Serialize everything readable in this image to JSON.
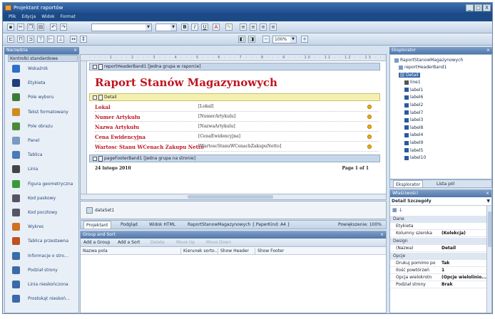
{
  "window": {
    "title": "Projektant raportów",
    "buttons": [
      "_",
      "□",
      "X"
    ]
  },
  "menu": [
    "Plik",
    "Edycja",
    "Widok",
    "Format"
  ],
  "toolbar": {
    "zoom": "100%",
    "zoom_icon": "zoom-icon"
  },
  "toolbox": {
    "title": "Narzędzia",
    "section": "Kontrolki standardowe",
    "items": [
      {
        "label": "Wskaźnik",
        "icon": "pointer-icon",
        "color": "#2c6fc9"
      },
      {
        "label": "Etykieta",
        "icon": "label-icon",
        "color": "#1f3f7a"
      },
      {
        "label": "Pole wyboru",
        "icon": "checkbox-icon",
        "color": "#3a7a3a"
      },
      {
        "label": "Tekst formatowany",
        "icon": "rich-text-icon",
        "color": "#d08a20"
      },
      {
        "label": "Pole obrazu",
        "icon": "picture-icon",
        "color": "#4a8a3a"
      },
      {
        "label": "Panel",
        "icon": "panel-icon",
        "color": "#7a9ac0"
      },
      {
        "label": "Tablica",
        "icon": "table-icon",
        "color": "#4a7ab8"
      },
      {
        "label": "Linia",
        "icon": "line-icon",
        "color": "#444"
      },
      {
        "label": "Figura geometryczna",
        "icon": "shape-icon",
        "color": "#3a9a3a"
      },
      {
        "label": "Kod paskowy",
        "icon": "barcode-icon",
        "color": "#556"
      },
      {
        "label": "Kod pocztowy",
        "icon": "zipcode-icon",
        "color": "#556"
      },
      {
        "label": "Wykres",
        "icon": "chart-icon",
        "color": "#d07020"
      },
      {
        "label": "Tablica przestawna",
        "icon": "pivot-icon",
        "color": "#c05020"
      },
      {
        "label": "Informacje o stro...",
        "icon": "page-info-icon",
        "color": "#3a6aa8"
      },
      {
        "label": "Podział strony",
        "icon": "page-break-icon",
        "color": "#3a6aa8"
      },
      {
        "label": "Linia nieskończona",
        "icon": "cross-line-icon",
        "color": "#3a6aa8"
      },
      {
        "label": "Prostokąt nieskoń...",
        "icon": "cross-rect-icon",
        "color": "#3a6aa8"
      }
    ]
  },
  "report": {
    "header_band": "reportHeaderBand1 [Jedna grupa w raporcie]",
    "title": "Raport Stanów Magazynowych",
    "detail_band": "Detail",
    "rows": [
      {
        "label": "Lokal",
        "value": "[Lokal]"
      },
      {
        "label": "Numer Artykułu",
        "value": "[NumerArtykulu]"
      },
      {
        "label": "Nazwa Artykułu",
        "value": "[NazwaArtykulu]"
      },
      {
        "label": "Cena Ewidencyjna",
        "value": "[CenaEwidencyjna]"
      },
      {
        "label": "Wartosc Stanu WCenach Zakupu Netto",
        "value": "[WartoscStanuWCenachZakupuNetto]"
      }
    ],
    "footer_band": "pageFooterBand1 [Jedna grupa na stronie]",
    "footer_date": "24 lutego 2010",
    "footer_page": "Page 1 of 1"
  },
  "data_source": "dataSet1",
  "tabs": {
    "items": [
      "Projektant",
      "Podgląd",
      "Widok HTML"
    ],
    "report_name": "RaportStanowMagazynowych { PaperKind: A4 }",
    "zoom_label": "Powiększenie: 100%"
  },
  "group_sort": {
    "title": "Group and Sort",
    "buttons": [
      "Add a Group",
      "Add a Sort",
      "Delete",
      "Move Up",
      "Move Down"
    ],
    "columns": [
      "Nazwa pola",
      "Kierunek sorto...",
      "Show Header",
      "Show Footer"
    ]
  },
  "explorer": {
    "title": "Eksplorator",
    "root": "RaportStanowMagazynowych",
    "nodes": [
      "reportHeaderBand1",
      "Detail",
      "line1",
      "label1",
      "label6",
      "label2",
      "label7",
      "label3",
      "label8",
      "label4",
      "label9",
      "label5",
      "label10"
    ],
    "tabs": [
      "Eksplorator",
      "Lista pól"
    ]
  },
  "properties": {
    "title": "Właściwości",
    "selected": "Detail  Szczegóły",
    "cat_data": "Dane",
    "cat_design": "Design",
    "cat_options": "Opcje",
    "rows": [
      {
        "name": "Etykieta",
        "value": ""
      },
      {
        "name": "Kolumny szeroka",
        "value": "(Kolekcja)"
      },
      {
        "name": "(Nazwa)",
        "value": "Detail"
      },
      {
        "name": "Drukuj pomimo po",
        "value": "Tak"
      },
      {
        "name": "Ilość powtórzeń",
        "value": "1"
      },
      {
        "name": "Opcja wielokrotn",
        "value": "(Opcje wielolinio..."
      },
      {
        "name": "Podział strony",
        "value": "Brak"
      }
    ]
  }
}
